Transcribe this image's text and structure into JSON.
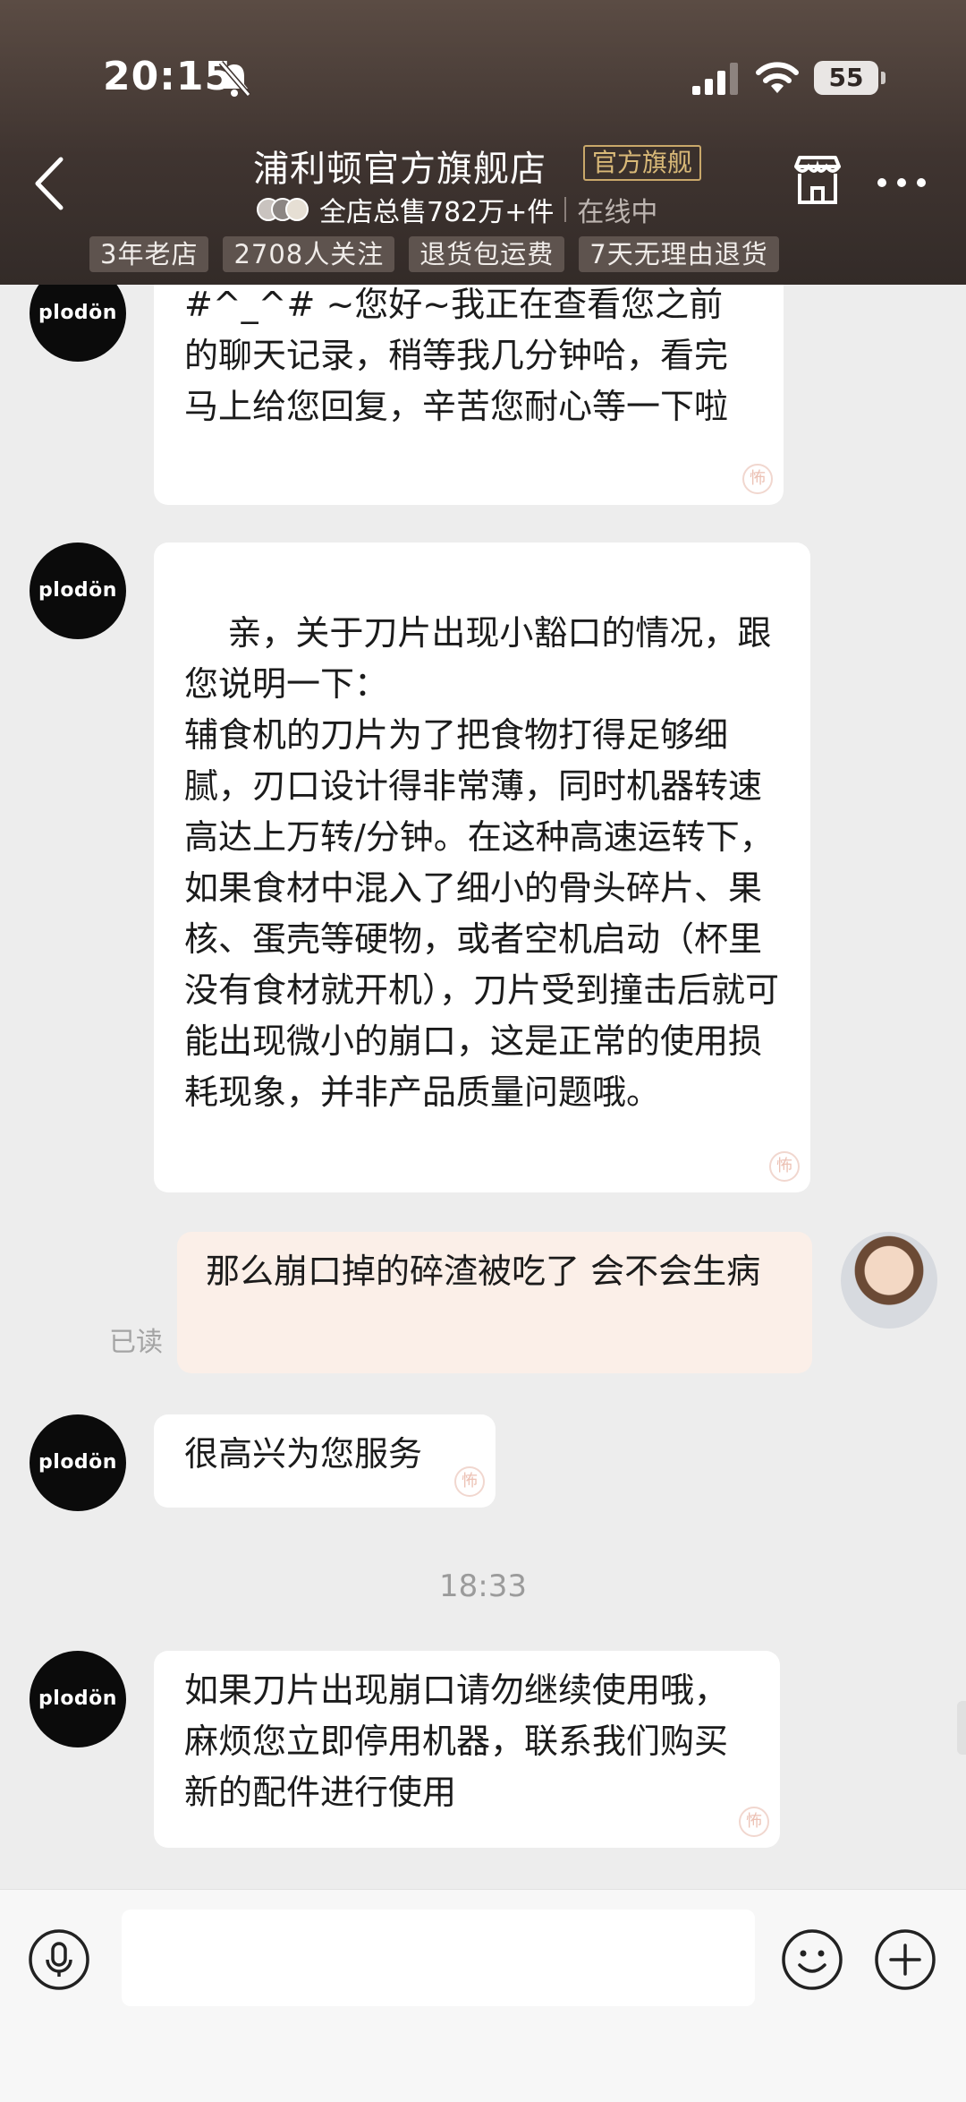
{
  "status_bar": {
    "time": "20:15",
    "battery": "55"
  },
  "header": {
    "shop_name": "浦利顿官方旗舰店",
    "badge": "官方旗舰",
    "total_sales": "全店总售782万+件",
    "status": "在线中",
    "tags": [
      "3年老店",
      "2708人关注",
      "退货包运费",
      "7天无理由退货"
    ]
  },
  "shop_logo_text": "plodön",
  "messages": [
    {
      "from": "shop",
      "text": "#^_^# ~您好~我正在查看您之前的聊天记录，稍等我几分钟哈，看完马上给您回复，辛苦您耐心等一下啦"
    },
    {
      "from": "shop",
      "text": "亲，关于刀片出现小豁口的情况，跟您说明一下：\n辅食机的刀片为了把食物打得足够细腻，刃口设计得非常薄，同时机器转速高达上万转/分钟。在这种高速运转下，如果食材中混入了细小的骨头碎片、果核、蛋壳等硬物，或者空机启动（杯里没有食材就开机），刀片受到撞击后就可能出现微小的崩口，这是正常的使用损耗现象，并非产品质量问题哦。"
    },
    {
      "from": "user",
      "text": "那么崩口掉的碎渣被吃了 会不会生病",
      "read_status": "已读"
    },
    {
      "from": "shop",
      "text": "很高兴为您服务"
    },
    {
      "from": "shop",
      "text": "如果刀片出现崩口请勿继续使用哦，麻烦您立即停用机器，联系我们购买新的配件进行使用"
    }
  ],
  "timestamp": "18:33",
  "input": {
    "placeholder": ""
  },
  "colors": {
    "header_bg": "#3f3430",
    "badge_gold": "#d9b978",
    "chat_bg": "#ededed",
    "user_bubble": "#fbefe8"
  }
}
